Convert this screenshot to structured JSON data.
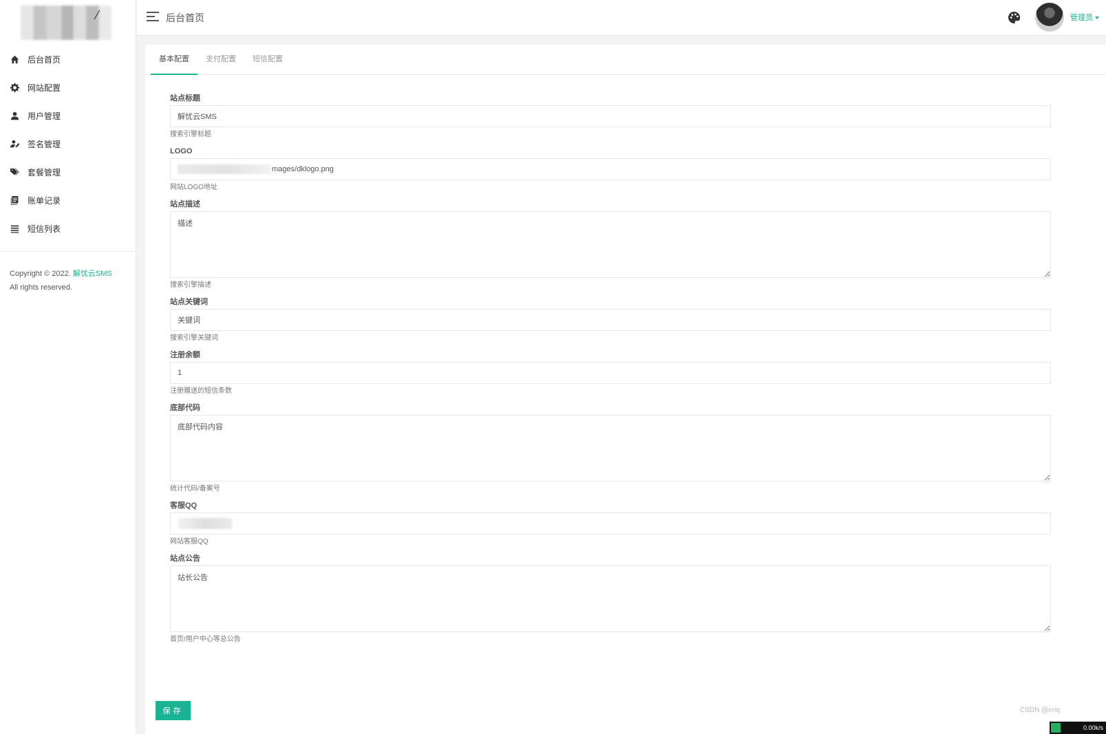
{
  "sidebar": {
    "items": [
      {
        "label": "后台首页",
        "icon": "home-icon"
      },
      {
        "label": "网站配置",
        "icon": "gear-icon"
      },
      {
        "label": "用户管理",
        "icon": "user-icon"
      },
      {
        "label": "签名管理",
        "icon": "signature-icon"
      },
      {
        "label": "套餐管理",
        "icon": "tags-icon"
      },
      {
        "label": "账单记录",
        "icon": "bill-icon"
      },
      {
        "label": "短信列表",
        "icon": "list-icon"
      }
    ],
    "copyright_prefix": "Copyright © 2022.",
    "copyright_brand": "解忧云SMS",
    "copyright_suffix": "All rights reserved."
  },
  "header": {
    "title": "后台首页",
    "user_label": "管理员"
  },
  "tabs": [
    {
      "label": "基本配置",
      "active": true
    },
    {
      "label": "支付配置",
      "active": false
    },
    {
      "label": "短信配置",
      "active": false
    }
  ],
  "form": {
    "site_title": {
      "label": "站点标题",
      "value": "解忧云SMS",
      "help": "搜索引擎标题"
    },
    "logo": {
      "label": "LOGO",
      "value": "mages/dklogo.png",
      "help": "网站LOGO地址"
    },
    "description": {
      "label": "站点描述",
      "value": "描述",
      "help": "搜索引擎描述"
    },
    "keywords": {
      "label": "站点关键词",
      "value": "关键词",
      "help": "搜索引擎关键词"
    },
    "register_balance": {
      "label": "注册余额",
      "value": "1",
      "help": "注册赠送的短信条数"
    },
    "footer_code": {
      "label": "底部代码",
      "value": "底部代码内容",
      "help": "统计代码/备案号"
    },
    "service_qq": {
      "label": "客服QQ",
      "value": "",
      "help": "网站客服QQ"
    },
    "announcement": {
      "label": "站点公告",
      "value": "站长公告",
      "help": "首页/用户中心等总公告"
    },
    "save_label": "保存"
  },
  "watermark": "CSDN @eriq",
  "corner_badge": "0.00k/s",
  "colors": {
    "accent": "#1ab394",
    "background": "#f3f3f4"
  }
}
